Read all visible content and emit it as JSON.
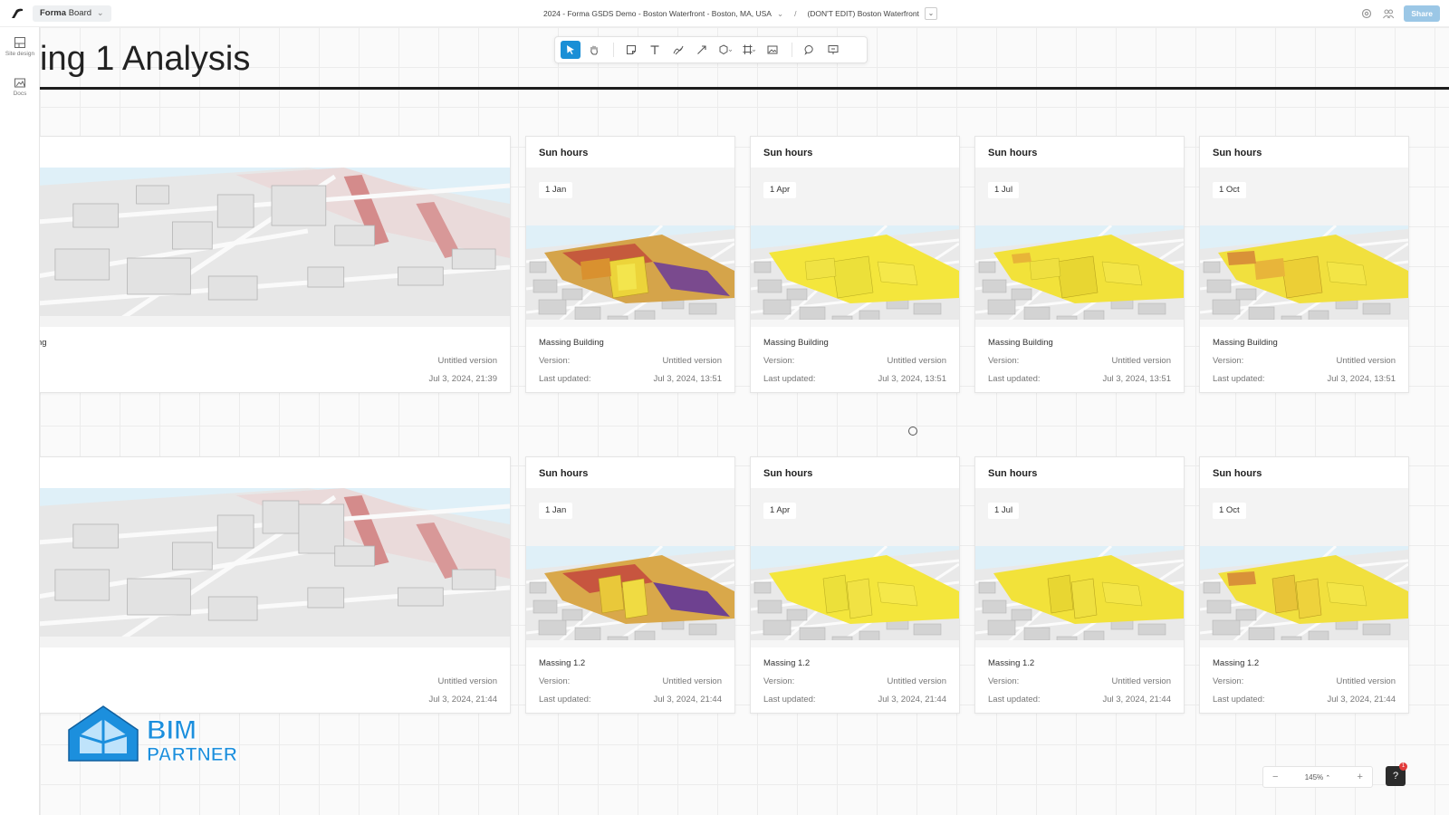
{
  "topbar": {
    "app_name": "Forma",
    "board_label": "Board",
    "project_path": "2024 - Forma GSDS Demo - Boston Waterfront - Boston, MA, USA",
    "separator": "/",
    "proposal_name": "(DON'T EDIT) Boston Waterfront",
    "share_label": "Share"
  },
  "left_rail": {
    "items": [
      {
        "label": "Site design",
        "icon": "site-design-icon"
      },
      {
        "label": "Docs",
        "icon": "docs-icon"
      }
    ]
  },
  "toolbar": {
    "tools": [
      "select-tool",
      "pan-tool",
      "sticky-note-tool",
      "text-tool",
      "pen-tool",
      "arrow-tool",
      "shape-tool",
      "frame-tool",
      "image-tool",
      "comment-tool",
      "present-tool"
    ]
  },
  "page": {
    "title": "ing 1 Analysis"
  },
  "rows": [
    {
      "big_card": {
        "name": "ng",
        "version_value": "Untitled version",
        "updated_value": "Jul 3, 2024, 21:39"
      },
      "cards": [
        {
          "title": "Sun hours",
          "date": "1 Jan",
          "name": "Massing Building",
          "version_label": "Version:",
          "version_value": "Untitled version",
          "updated_label": "Last updated:",
          "updated_value": "Jul 3, 2024, 13:51"
        },
        {
          "title": "Sun hours",
          "date": "1 Apr",
          "name": "Massing Building",
          "version_label": "Version:",
          "version_value": "Untitled version",
          "updated_label": "Last updated:",
          "updated_value": "Jul 3, 2024, 13:51"
        },
        {
          "title": "Sun hours",
          "date": "1 Jul",
          "name": "Massing Building",
          "version_label": "Version:",
          "version_value": "Untitled version",
          "updated_label": "Last updated:",
          "updated_value": "Jul 3, 2024, 13:51"
        },
        {
          "title": "Sun hours",
          "date": "1 Oct",
          "name": "Massing Building",
          "version_label": "Version:",
          "version_value": "Untitled version",
          "updated_label": "Last updated:",
          "updated_value": "Jul 3, 2024, 13:51"
        }
      ]
    },
    {
      "big_card": {
        "name": "",
        "version_value": "Untitled version",
        "updated_value": "Jul 3, 2024, 21:44"
      },
      "cards": [
        {
          "title": "Sun hours",
          "date": "1 Jan",
          "name": "Massing 1.2",
          "version_label": "Version:",
          "version_value": "Untitled version",
          "updated_label": "Last updated:",
          "updated_value": "Jul 3, 2024, 21:44"
        },
        {
          "title": "Sun hours",
          "date": "1 Apr",
          "name": "Massing 1.2",
          "version_label": "Version:",
          "version_value": "Untitled version",
          "updated_label": "Last updated:",
          "updated_value": "Jul 3, 2024, 21:44"
        },
        {
          "title": "Sun hours",
          "date": "1 Jul",
          "name": "Massing 1.2",
          "version_label": "Version:",
          "version_value": "Untitled version",
          "updated_label": "Last updated:",
          "updated_value": "Jul 3, 2024, 21:44"
        },
        {
          "title": "Sun hours",
          "date": "1 Oct",
          "name": "Massing 1.2",
          "version_label": "Version:",
          "version_value": "Untitled version",
          "updated_label": "Last updated:",
          "updated_value": "Jul 3, 2024, 21:44"
        }
      ]
    }
  ],
  "zoom": {
    "minus": "−",
    "level": "145%",
    "plus": "+"
  },
  "help": {
    "badge": "1"
  },
  "watermark": {
    "line1": "BIM",
    "line2": "PARTNER"
  },
  "colors": {
    "accent": "#1a8fd6",
    "share": "#9bc7e6",
    "sun_yellow": "#f4e63c",
    "sun_orange": "#e7a13a",
    "sun_red": "#c2413a",
    "sun_purple": "#6b3f8c",
    "water": "#dff0f8",
    "logo_blue": "#1c8fdd"
  }
}
